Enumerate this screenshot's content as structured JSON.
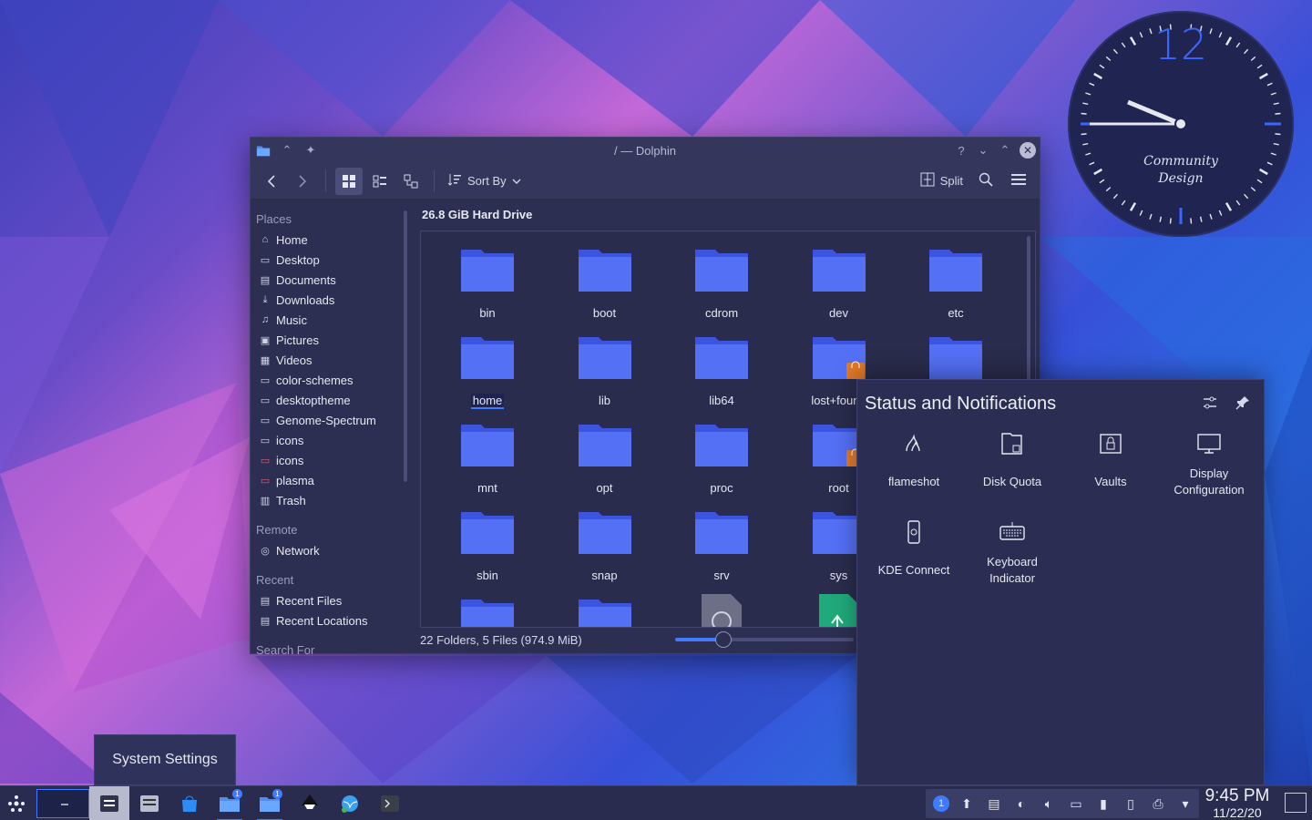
{
  "clock": {
    "hour_label": "12",
    "brand_line1": "Community",
    "brand_line2": "Design"
  },
  "dolphin": {
    "title": "/ — Dolphin",
    "toolbar": {
      "sort_label": "Sort By",
      "split_label": "Split"
    },
    "places": {
      "header": "Places",
      "items": [
        {
          "label": "Home",
          "icon": "home-icon"
        },
        {
          "label": "Desktop",
          "icon": "desktop-icon"
        },
        {
          "label": "Documents",
          "icon": "documents-icon"
        },
        {
          "label": "Downloads",
          "icon": "downloads-icon"
        },
        {
          "label": "Music",
          "icon": "music-icon"
        },
        {
          "label": "Pictures",
          "icon": "pictures-icon"
        },
        {
          "label": "Videos",
          "icon": "videos-icon"
        },
        {
          "label": "color-schemes",
          "icon": "folder-icon"
        },
        {
          "label": "desktoptheme",
          "icon": "folder-icon"
        },
        {
          "label": "Genome-Spectrum",
          "icon": "folder-icon"
        },
        {
          "label": "icons",
          "icon": "folder-icon"
        },
        {
          "label": "icons",
          "icon": "folder-red-icon"
        },
        {
          "label": "plasma",
          "icon": "folder-red-icon"
        },
        {
          "label": "Trash",
          "icon": "trash-icon"
        }
      ]
    },
    "remote": {
      "header": "Remote",
      "items": [
        {
          "label": "Network",
          "icon": "network-icon"
        }
      ]
    },
    "recent": {
      "header": "Recent",
      "items": [
        {
          "label": "Recent Files",
          "icon": "recent-files-icon"
        },
        {
          "label": "Recent Locations",
          "icon": "recent-locations-icon"
        }
      ]
    },
    "search_header": "Search For",
    "drive_label": "26.8 GiB Hard Drive",
    "folders": [
      "bin",
      "boot",
      "cdrom",
      "dev",
      "etc",
      "home",
      "lib",
      "lib64",
      "lost+found",
      "",
      "mnt",
      "opt",
      "proc",
      "root",
      "",
      "sbin",
      "snap",
      "srv",
      "sys",
      ""
    ],
    "status_text": "22 Folders, 5 Files (974.9 MiB)",
    "zoom_fraction": 0.27
  },
  "notifications": {
    "title": "Status and Notifications",
    "items": [
      {
        "label": "flameshot",
        "icon": "flameshot-icon"
      },
      {
        "label": "Disk Quota",
        "icon": "disk-quota-icon"
      },
      {
        "label": "Vaults",
        "icon": "vaults-icon"
      },
      {
        "label": "Display Configuration",
        "icon": "display-icon"
      },
      {
        "label": "KDE Connect",
        "icon": "kde-connect-icon"
      },
      {
        "label": "Keyboard Indicator",
        "icon": "keyboard-icon"
      }
    ]
  },
  "tooltip": "System Settings",
  "taskbar": {
    "badge": "1",
    "tray_badge": "1",
    "time": "9:45 PM",
    "date": "11/22/20"
  },
  "colors": {
    "accent": "#3f7bff",
    "folder": "#4f6df5",
    "panel": "#2a2c4f"
  }
}
